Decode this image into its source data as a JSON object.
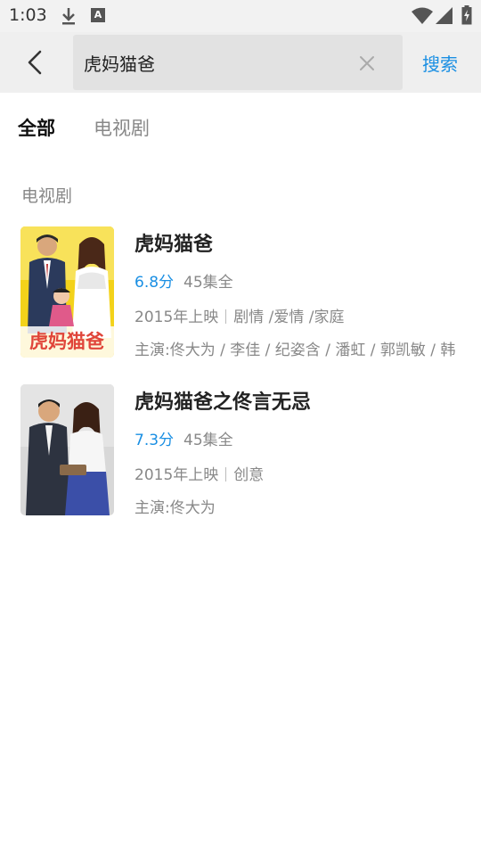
{
  "status_bar": {
    "time": "1:03",
    "icons": [
      "download-icon",
      "a-icon",
      "wifi-icon",
      "signal-icon",
      "battery-icon"
    ],
    "a_label": "A"
  },
  "header": {
    "search_value": "虎妈猫爸",
    "search_button_label": "搜索",
    "icons": [
      "back-arrow-icon",
      "clear-icon"
    ]
  },
  "tabs": [
    {
      "label": "全部",
      "active": true
    },
    {
      "label": "电视剧",
      "active": false
    }
  ],
  "section": {
    "title": "电视剧"
  },
  "results": [
    {
      "title": "虎妈猫爸",
      "score": "6.8分",
      "episodes": "45集全",
      "release": "2015年上映",
      "genres": "剧情 /爱情 /家庭",
      "cast": "主演:佟大为 / 李佳 / 纪姿含 / 潘虹 / 郭凯敏 / 韩",
      "poster_text": "虎妈猫爸"
    },
    {
      "title": "虎妈猫爸之佟言无忌",
      "score": "7.3分",
      "episodes": "45集全",
      "release": "2015年上映",
      "genres": "创意",
      "cast": "主演:佟大为"
    }
  ],
  "colors": {
    "accent": "#1a8fe3",
    "header_bg": "#efefef",
    "search_box_bg": "#e2e2e2",
    "secondary_text": "#888888"
  }
}
